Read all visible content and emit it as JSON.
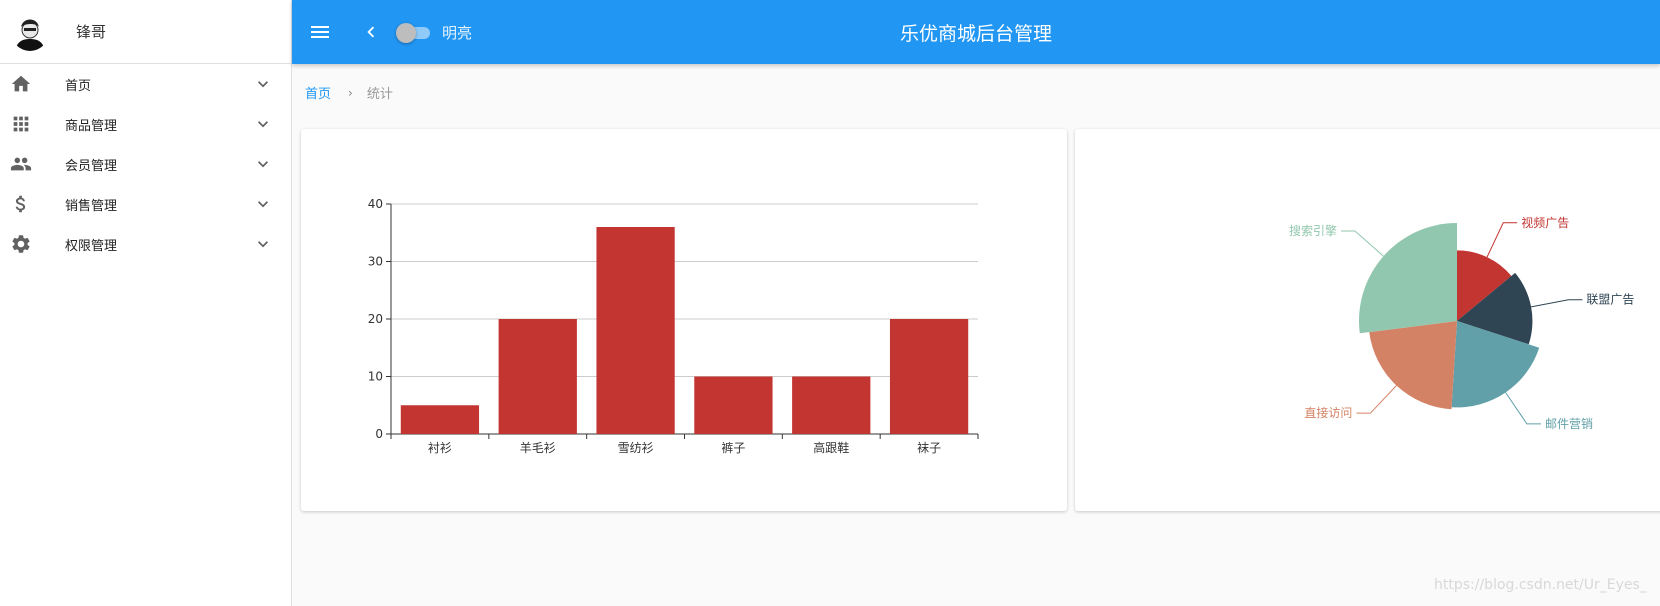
{
  "sidebar": {
    "user": {
      "name": "锋哥"
    },
    "items": [
      {
        "label": "首页",
        "icon": "home-icon"
      },
      {
        "label": "商品管理",
        "icon": "apps-grid-icon"
      },
      {
        "label": "会员管理",
        "icon": "people-icon"
      },
      {
        "label": "销售管理",
        "icon": "dollar-icon"
      },
      {
        "label": "权限管理",
        "icon": "gear-icon"
      }
    ]
  },
  "header": {
    "title": "乐优商城后台管理",
    "theme_toggle_label": "明亮",
    "theme_toggle_on": false,
    "bg_color": "#2196f3"
  },
  "breadcrumb": {
    "home": "首页",
    "current": "统计"
  },
  "watermark": "https://blog.csdn.net/Ur_Eyes_",
  "chart_data": [
    {
      "type": "bar",
      "categories": [
        "衬衫",
        "羊毛衫",
        "雪纺衫",
        "裤子",
        "高跟鞋",
        "袜子"
      ],
      "values": [
        5,
        20,
        36,
        10,
        10,
        20
      ],
      "ylim": [
        0,
        40
      ],
      "yticks": [
        0,
        10,
        20,
        30,
        40
      ],
      "grid": true,
      "color": "#c23531"
    },
    {
      "type": "pie",
      "variant": "rose",
      "slices": [
        {
          "name": "视频广告",
          "value": 14,
          "color": "#c23531"
        },
        {
          "name": "联盟广告",
          "value": 16,
          "color": "#2f4554"
        },
        {
          "name": "邮件营销",
          "value": 21,
          "color": "#61a0a8"
        },
        {
          "name": "直接访问",
          "value": 22,
          "color": "#d48265"
        },
        {
          "name": "搜索引擎",
          "value": 27,
          "color": "#91c7ae"
        }
      ]
    }
  ]
}
